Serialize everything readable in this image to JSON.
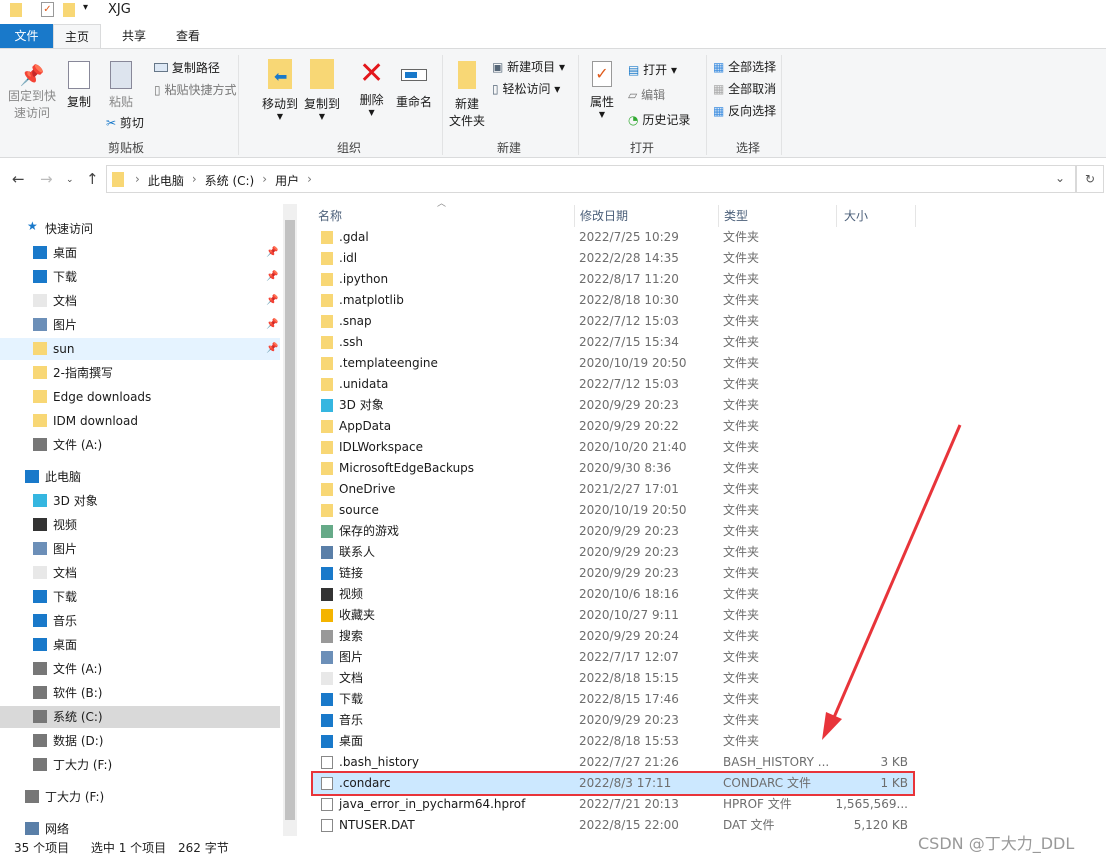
{
  "window": {
    "title": "XJG"
  },
  "tabs": [
    {
      "label": "文件"
    },
    {
      "label": "主页"
    },
    {
      "label": "共享"
    },
    {
      "label": "查看"
    }
  ],
  "ribbon": {
    "clipboard": {
      "pin": "固定到快",
      "pin2": "速访问",
      "copy": "复制",
      "paste": "粘贴",
      "copy_path": "复制路径",
      "paste_shortcut": "粘贴快捷方式",
      "cut": "剪切",
      "group": "剪贴板"
    },
    "organize": {
      "move_to": "移动到",
      "copy_to": "复制到",
      "delete": "删除",
      "rename": "重命名",
      "group": "组织"
    },
    "new": {
      "new_folder": "新建",
      "new_folder2": "文件夹",
      "new_item": "新建项目",
      "easy_access": "轻松访问",
      "group": "新建"
    },
    "open": {
      "properties": "属性",
      "open": "打开",
      "edit": "编辑",
      "history": "历史记录",
      "group": "打开"
    },
    "select": {
      "select_all": "全部选择",
      "select_none": "全部取消",
      "invert": "反向选择",
      "group": "选择"
    }
  },
  "address": {
    "crumbs": [
      "此电脑",
      "系统 (C:)",
      "用户"
    ]
  },
  "sidebar": {
    "quick_access": "快速访问",
    "quick": [
      {
        "label": "桌面",
        "icon": "desktop",
        "pin": true
      },
      {
        "label": "下载",
        "icon": "download",
        "pin": true
      },
      {
        "label": "文档",
        "icon": "document",
        "pin": true
      },
      {
        "label": "图片",
        "icon": "picture",
        "pin": true
      },
      {
        "label": "sun",
        "icon": "folder",
        "pin": true
      },
      {
        "label": "2-指南撰写",
        "icon": "folder"
      },
      {
        "label": "Edge downloads",
        "icon": "folder"
      },
      {
        "label": "IDM download",
        "icon": "folder"
      },
      {
        "label": "文件 (A:)",
        "icon": "drive"
      }
    ],
    "this_pc": "此电脑",
    "pc": [
      {
        "label": "3D 对象",
        "icon": "3d"
      },
      {
        "label": "视频",
        "icon": "video"
      },
      {
        "label": "图片",
        "icon": "picture"
      },
      {
        "label": "文档",
        "icon": "document"
      },
      {
        "label": "下载",
        "icon": "download"
      },
      {
        "label": "音乐",
        "icon": "music"
      },
      {
        "label": "桌面",
        "icon": "desktop"
      },
      {
        "label": "文件 (A:)",
        "icon": "drive"
      },
      {
        "label": "软件 (B:)",
        "icon": "drive"
      },
      {
        "label": "系统 (C:)",
        "icon": "drive",
        "selected": true
      },
      {
        "label": "数据 (D:)",
        "icon": "drive"
      },
      {
        "label": "丁大力 (F:)",
        "icon": "drive"
      }
    ],
    "drive_f": "丁大力 (F:)",
    "network": "网络"
  },
  "columns": {
    "name": "名称",
    "date": "修改日期",
    "type": "类型",
    "size": "大小"
  },
  "files": [
    {
      "name": ".gdal",
      "date": "2022/7/25 10:29",
      "type": "文件夹",
      "size": "",
      "icon": "folder"
    },
    {
      "name": ".idl",
      "date": "2022/2/28 14:35",
      "type": "文件夹",
      "size": "",
      "icon": "folder"
    },
    {
      "name": ".ipython",
      "date": "2022/8/17 11:20",
      "type": "文件夹",
      "size": "",
      "icon": "folder"
    },
    {
      "name": ".matplotlib",
      "date": "2022/8/18 10:30",
      "type": "文件夹",
      "size": "",
      "icon": "folder"
    },
    {
      "name": ".snap",
      "date": "2022/7/12 15:03",
      "type": "文件夹",
      "size": "",
      "icon": "folder"
    },
    {
      "name": ".ssh",
      "date": "2022/7/15 15:34",
      "type": "文件夹",
      "size": "",
      "icon": "folder"
    },
    {
      "name": ".templateengine",
      "date": "2020/10/19 20:50",
      "type": "文件夹",
      "size": "",
      "icon": "folder"
    },
    {
      "name": ".unidata",
      "date": "2022/7/12 15:03",
      "type": "文件夹",
      "size": "",
      "icon": "folder"
    },
    {
      "name": "3D 对象",
      "date": "2020/9/29 20:23",
      "type": "文件夹",
      "size": "",
      "icon": "3d"
    },
    {
      "name": "AppData",
      "date": "2020/9/29 20:22",
      "type": "文件夹",
      "size": "",
      "icon": "folder"
    },
    {
      "name": "IDLWorkspace",
      "date": "2020/10/20 21:40",
      "type": "文件夹",
      "size": "",
      "icon": "folder"
    },
    {
      "name": "MicrosoftEdgeBackups",
      "date": "2020/9/30 8:36",
      "type": "文件夹",
      "size": "",
      "icon": "folder"
    },
    {
      "name": "OneDrive",
      "date": "2021/2/27 17:01",
      "type": "文件夹",
      "size": "",
      "icon": "folder"
    },
    {
      "name": "source",
      "date": "2020/10/19 20:50",
      "type": "文件夹",
      "size": "",
      "icon": "folder"
    },
    {
      "name": "保存的游戏",
      "date": "2020/9/29 20:23",
      "type": "文件夹",
      "size": "",
      "icon": "games"
    },
    {
      "name": "联系人",
      "date": "2020/9/29 20:23",
      "type": "文件夹",
      "size": "",
      "icon": "contacts"
    },
    {
      "name": "链接",
      "date": "2020/9/29 20:23",
      "type": "文件夹",
      "size": "",
      "icon": "links"
    },
    {
      "name": "视频",
      "date": "2020/10/6 18:16",
      "type": "文件夹",
      "size": "",
      "icon": "video"
    },
    {
      "name": "收藏夹",
      "date": "2020/10/27 9:11",
      "type": "文件夹",
      "size": "",
      "icon": "favorites"
    },
    {
      "name": "搜索",
      "date": "2020/9/29 20:24",
      "type": "文件夹",
      "size": "",
      "icon": "search"
    },
    {
      "name": "图片",
      "date": "2022/7/17 12:07",
      "type": "文件夹",
      "size": "",
      "icon": "picture"
    },
    {
      "name": "文档",
      "date": "2022/8/18 15:15",
      "type": "文件夹",
      "size": "",
      "icon": "document"
    },
    {
      "name": "下载",
      "date": "2022/8/15 17:46",
      "type": "文件夹",
      "size": "",
      "icon": "download"
    },
    {
      "name": "音乐",
      "date": "2020/9/29 20:23",
      "type": "文件夹",
      "size": "",
      "icon": "music"
    },
    {
      "name": "桌面",
      "date": "2022/8/18 15:53",
      "type": "文件夹",
      "size": "",
      "icon": "desktop"
    },
    {
      "name": ".bash_history",
      "date": "2022/7/27 21:26",
      "type": "BASH_HISTORY ...",
      "size": "3 KB",
      "icon": "file"
    },
    {
      "name": ".condarc",
      "date": "2022/8/3 17:11",
      "type": "CONDARC 文件",
      "size": "1 KB",
      "icon": "file",
      "selected": true
    },
    {
      "name": "java_error_in_pycharm64.hprof",
      "date": "2022/7/21 20:13",
      "type": "HPROF 文件",
      "size": "1,565,569...",
      "icon": "file"
    },
    {
      "name": "NTUSER.DAT",
      "date": "2022/8/15 22:00",
      "type": "DAT 文件",
      "size": "5,120 KB",
      "icon": "file"
    }
  ],
  "status": {
    "count": "35 个项目",
    "selected": "选中 1 个项目",
    "size": "262 字节"
  },
  "watermark": "CSDN @丁大力_DDL",
  "colors": {
    "accent": "#1979ca",
    "selection": "#cce8ff",
    "highlight_box": "#e8343a",
    "arrow": "#e8343a",
    "folder": "#f8d775"
  }
}
